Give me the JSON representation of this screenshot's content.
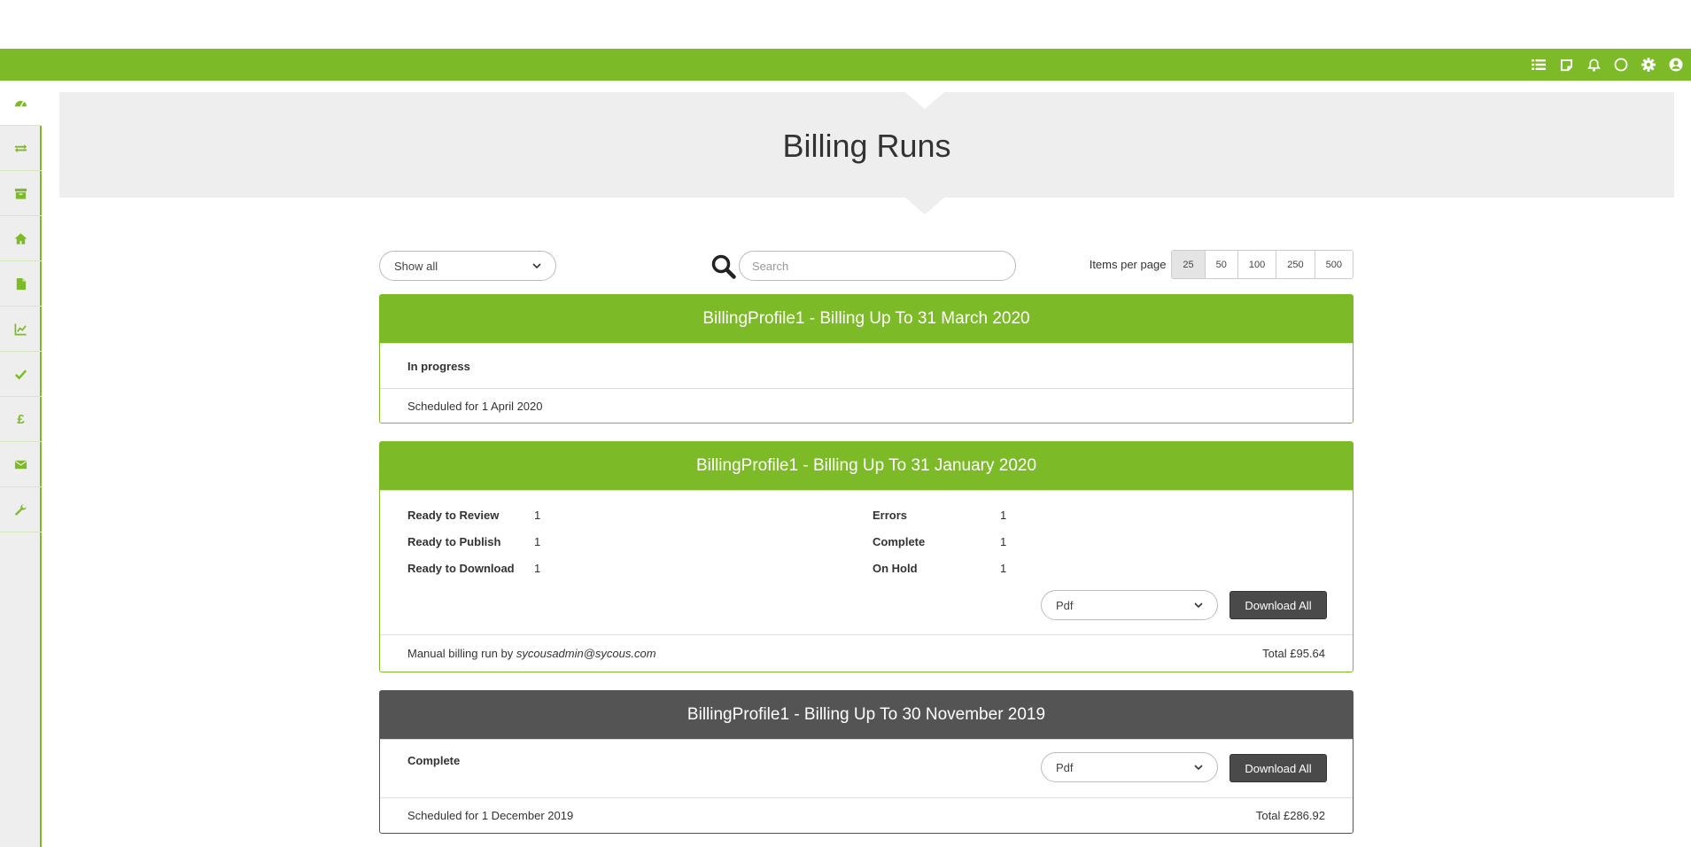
{
  "page_title": "Billing Runs",
  "topbar": {
    "icons": [
      "list-icon",
      "note-icon",
      "bell-icon",
      "circle-icon",
      "gear-icon",
      "user-icon"
    ]
  },
  "sidebar": {
    "items": [
      "dashboard-icon",
      "exchange-icon",
      "archive-icon",
      "home-icon",
      "file-icon",
      "chart-icon",
      "check-icon",
      "pound-icon",
      "envelope-icon",
      "wrench-icon"
    ],
    "pound_glyph": "£"
  },
  "filter": {
    "selected": "Show all"
  },
  "search": {
    "placeholder": "Search"
  },
  "items_per_page": {
    "label": "Items per page",
    "options": [
      "25",
      "50",
      "100",
      "250",
      "500"
    ],
    "selected": "25"
  },
  "runs": [
    {
      "title": "BillingProfile1 - Billing Up To 31 March 2020",
      "status": "In progress",
      "footer": "Scheduled for 1 April 2020"
    },
    {
      "title": "BillingProfile1 - Billing Up To 31 January 2020",
      "stats_left": [
        {
          "label": "Ready to Review",
          "value": "1"
        },
        {
          "label": "Ready to Publish",
          "value": "1"
        },
        {
          "label": "Ready to Download",
          "value": "1"
        }
      ],
      "stats_right": [
        {
          "label": "Errors",
          "value": "1"
        },
        {
          "label": "Complete",
          "value": "1"
        },
        {
          "label": "On Hold",
          "value": "1"
        }
      ],
      "format": "Pdf",
      "download_label": "Download All",
      "footer_prefix": "Manual billing run by ",
      "footer_user": "sycousadmin@sycous.com",
      "total": "Total £95.64"
    },
    {
      "title": "BillingProfile1 - Billing Up To 30 November 2019",
      "status": "Complete",
      "format": "Pdf",
      "download_label": "Download All",
      "footer": "Scheduled for 1 December 2019",
      "total": "Total £286.92"
    }
  ],
  "colors": {
    "brand": "#7dba28",
    "dark_header": "#545454",
    "hero_bg": "#eeeeee"
  }
}
